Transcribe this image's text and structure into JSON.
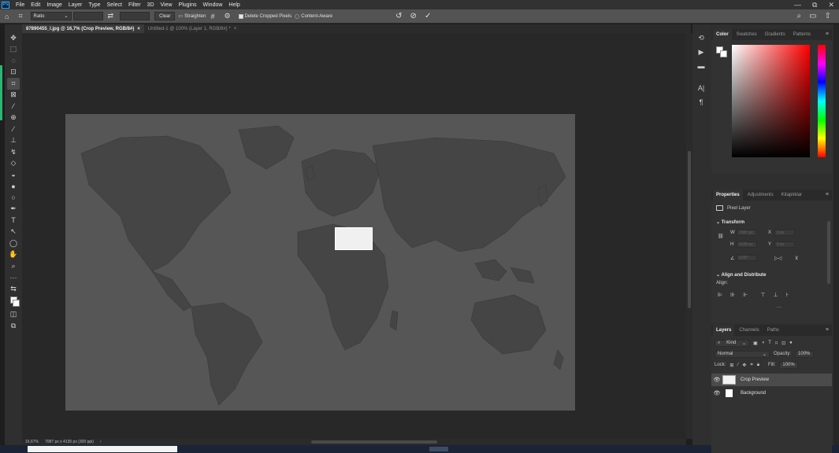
{
  "menubar": {
    "app_icon": "Ps",
    "items": [
      "File",
      "Edit",
      "Image",
      "Layer",
      "Type",
      "Select",
      "Filter",
      "3D",
      "View",
      "Plugins",
      "Window",
      "Help"
    ],
    "window_controls": [
      "—",
      "⧉",
      "✕"
    ]
  },
  "options_bar": {
    "ratio_select": "Ratio",
    "swap_icon": "⇄",
    "clear_label": "Clear",
    "straighten_label": "Straighten",
    "delete_cropped_label": "Delete Cropped Pixels",
    "content_aware_label": "Content-Aware",
    "delete_cropped_checked": true,
    "content_aware_checked": false
  },
  "doc_tabs": [
    {
      "label": "87890455_l.jpg @ 16,7% (Crop Preview, RGB/8#)",
      "close": "×",
      "active": true
    },
    {
      "label": "Untitled-1 @ 100% (Layer 1, RGB/8#) *",
      "close": "×",
      "active": false
    }
  ],
  "status": {
    "zoom": "16,67%",
    "doc_size": "7087 px x 4135 px (300 ppi)",
    "arrow": "›"
  },
  "color_panel": {
    "tabs": [
      "Color",
      "Swatches",
      "Gradients",
      "Patterns"
    ],
    "active_tab": "Color"
  },
  "properties_panel": {
    "tabs": [
      "Properties",
      "Adjustments",
      "Kitaplıklar"
    ],
    "active_tab": "Properties",
    "layer_type": "Pixel Layer",
    "transform_label": "Transform",
    "w_label": "W",
    "h_label": "H",
    "x_label": "X",
    "y_label": "Y",
    "w_value": "7087 px",
    "h_value": "4135 px",
    "x_value": "0 px",
    "y_value": "0 px",
    "angle_value": "0,00°",
    "align_label": "Align and Distribute",
    "align_sub": "Align:",
    "more": "···"
  },
  "layers_panel": {
    "tabs": [
      "Layers",
      "Channels",
      "Paths"
    ],
    "active_tab": "Layers",
    "kind_label": "Kind",
    "blend_mode": "Normal",
    "opacity_label": "Opacity:",
    "opacity_value": "100%",
    "lock_label": "Lock:",
    "fill_label": "Fill:",
    "fill_value": "100%",
    "layers": [
      {
        "name": "Crop Preview",
        "selected": true
      },
      {
        "name": "Background",
        "selected": false
      }
    ]
  },
  "colors": {
    "canvas_bg": "#282828",
    "doc_bg": "#565656",
    "map_land": "#454545",
    "accent_green": "#2bb673"
  }
}
